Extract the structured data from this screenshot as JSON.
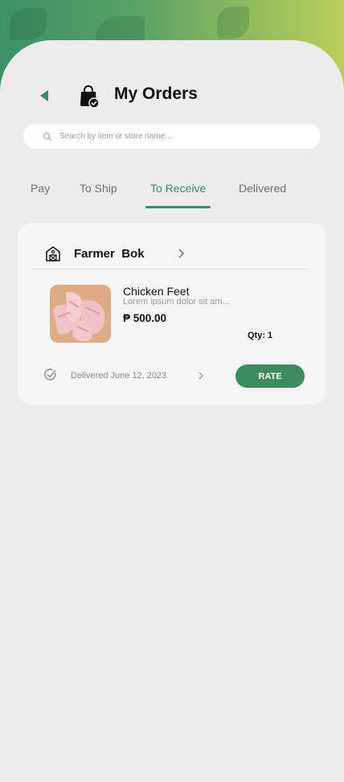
{
  "header": {
    "title": "My Orders",
    "back_icon": "back-arrow-icon",
    "bag_icon": "shopping-bag-check-icon"
  },
  "search": {
    "placeholder": "Search by item or store name...",
    "icon": "search-icon"
  },
  "tabs": [
    {
      "label": "Pay"
    },
    {
      "label": "To Ship"
    },
    {
      "label": "To Receive",
      "active": true
    },
    {
      "label": "Delivered"
    }
  ],
  "order": {
    "store": {
      "name": "Farmer  Bok",
      "icon": "store-barn-icon"
    },
    "product": {
      "name": "Chicken Feet",
      "description": "Lorem ipsum dolor sit am...",
      "price": "₱ 500.00",
      "qty": "Qty: 1"
    },
    "status": {
      "text": "Delivered June 12, 2023",
      "icon": "check-circle-icon"
    },
    "rate_label": "RATE"
  },
  "colors": {
    "accent": "#3b8a60",
    "background": "#ececec",
    "card": "#f5f5f5",
    "gradient_start": "#3d9066",
    "gradient_end": "#b9cf5b"
  }
}
